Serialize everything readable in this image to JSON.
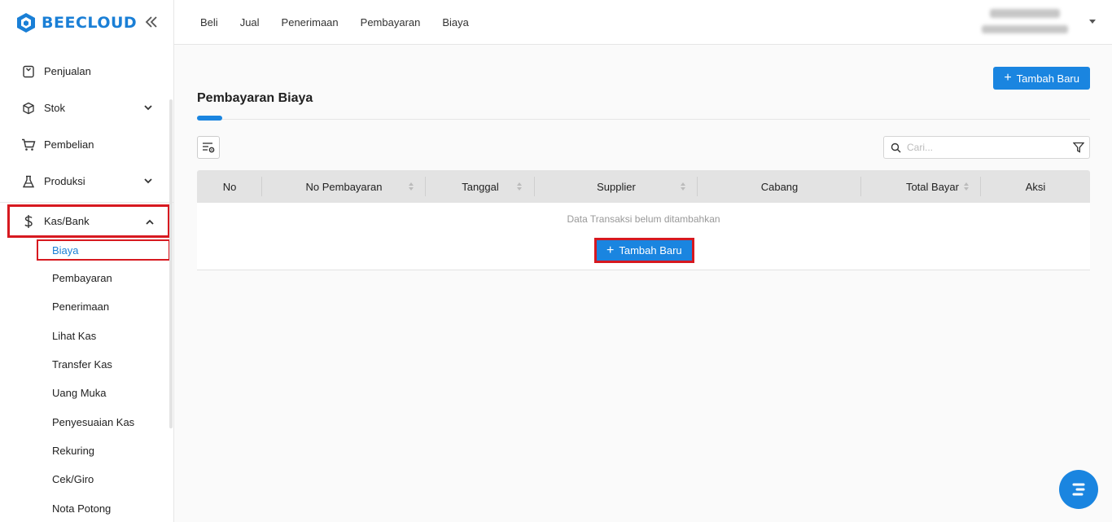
{
  "brand": {
    "name": "BEECLOUD",
    "accent": "#1a85e0",
    "highlight": "#d71920"
  },
  "sidebar": {
    "items": [
      {
        "label": "Penjualan",
        "icon": "receipt-icon"
      },
      {
        "label": "Stok",
        "icon": "box-icon"
      },
      {
        "label": "Pembelian",
        "icon": "cart-icon"
      },
      {
        "label": "Produksi",
        "icon": "flask-icon"
      },
      {
        "label": "Kas/Bank",
        "icon": "dollar-icon"
      }
    ],
    "sub_items": [
      "Biaya",
      "Pembayaran",
      "Penerimaan",
      "Lihat Kas",
      "Transfer Kas",
      "Uang Muka",
      "Penyesuaian Kas",
      "Rekuring",
      "Cek/Giro",
      "Nota Potong"
    ]
  },
  "topnav": [
    "Beli",
    "Jual",
    "Penerimaan",
    "Pembayaran",
    "Biaya"
  ],
  "page": {
    "title": "Pembayaran Biaya",
    "add_label": "Tambah Baru",
    "search_placeholder": "Cari..."
  },
  "table": {
    "columns": [
      "No",
      "No Pembayaran",
      "Tanggal",
      "Supplier",
      "Cabang",
      "Total Bayar",
      "Aksi"
    ],
    "empty_text": "Data Transaksi belum ditambahkan",
    "empty_add_label": "Tambah Baru"
  }
}
